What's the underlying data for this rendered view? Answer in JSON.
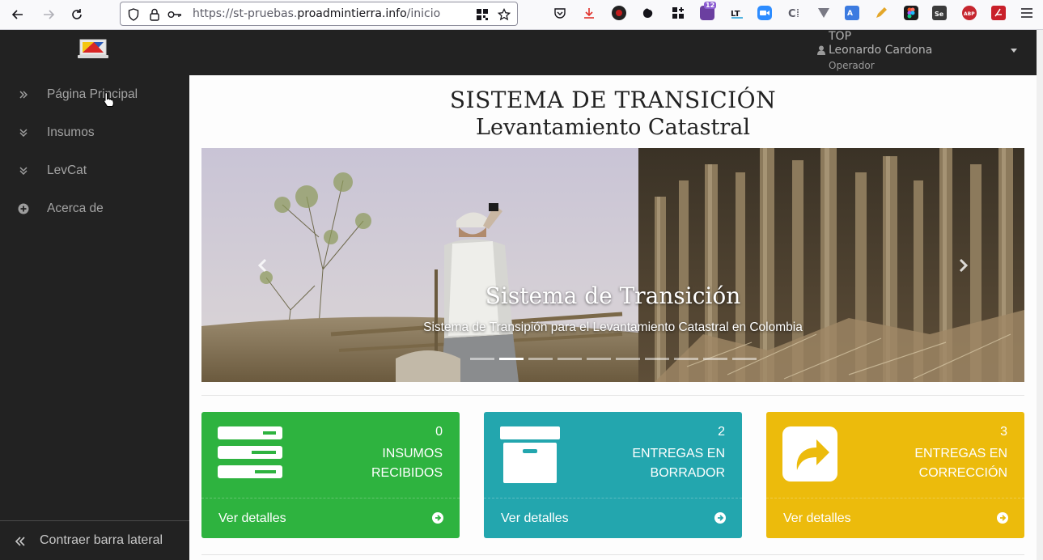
{
  "browser": {
    "url_prefix": "https://st-pruebas.",
    "url_domain": "proadmintierra.info",
    "url_path": "/inicio",
    "notification_count": "12"
  },
  "header": {
    "user_role_top": "TOP",
    "user_name": "Leonardo Cardona",
    "user_role": "Operador"
  },
  "sidebar": {
    "items": [
      {
        "label": "Página Principal",
        "icon": "double-chevron-right-icon"
      },
      {
        "label": "Insumos",
        "icon": "double-chevron-down-icon"
      },
      {
        "label": "LevCat",
        "icon": "double-chevron-down-icon"
      },
      {
        "label": "Acerca de",
        "icon": "plus-circle-icon"
      }
    ],
    "collapse_label": "Contraer barra lateral"
  },
  "main": {
    "title": "SISTEMA DE TRANSICIÓN",
    "subtitle": "Levantamiento Catastral",
    "carousel": {
      "caption_title": "Sistema de Transición",
      "caption_text": "Sistema de Transipión para el Levantamiento Catastral en Colombia",
      "indicator_count": 10,
      "active_indicator": 1
    },
    "panels": [
      {
        "count": "0",
        "label_line1": "INSUMOS",
        "label_line2": "RECIBIDOS",
        "details": "Ver detalles",
        "color": "#2eb33f",
        "icon": "server-icon"
      },
      {
        "count": "2",
        "label_line1": "ENTREGAS EN",
        "label_line2": "BORRADOR",
        "details": "Ver detalles",
        "color": "#23a6ae",
        "icon": "archive-icon"
      },
      {
        "count": "3",
        "label_line1": "ENTREGAS EN",
        "label_line2": "CORRECCIÓN",
        "details": "Ver detalles",
        "color": "#ecbb0c",
        "icon": "share-icon"
      }
    ]
  },
  "colors": {
    "sidebar_bg": "#222222",
    "green": "#2eb33f",
    "teal": "#23a6ae",
    "yellow": "#ecbb0c"
  }
}
